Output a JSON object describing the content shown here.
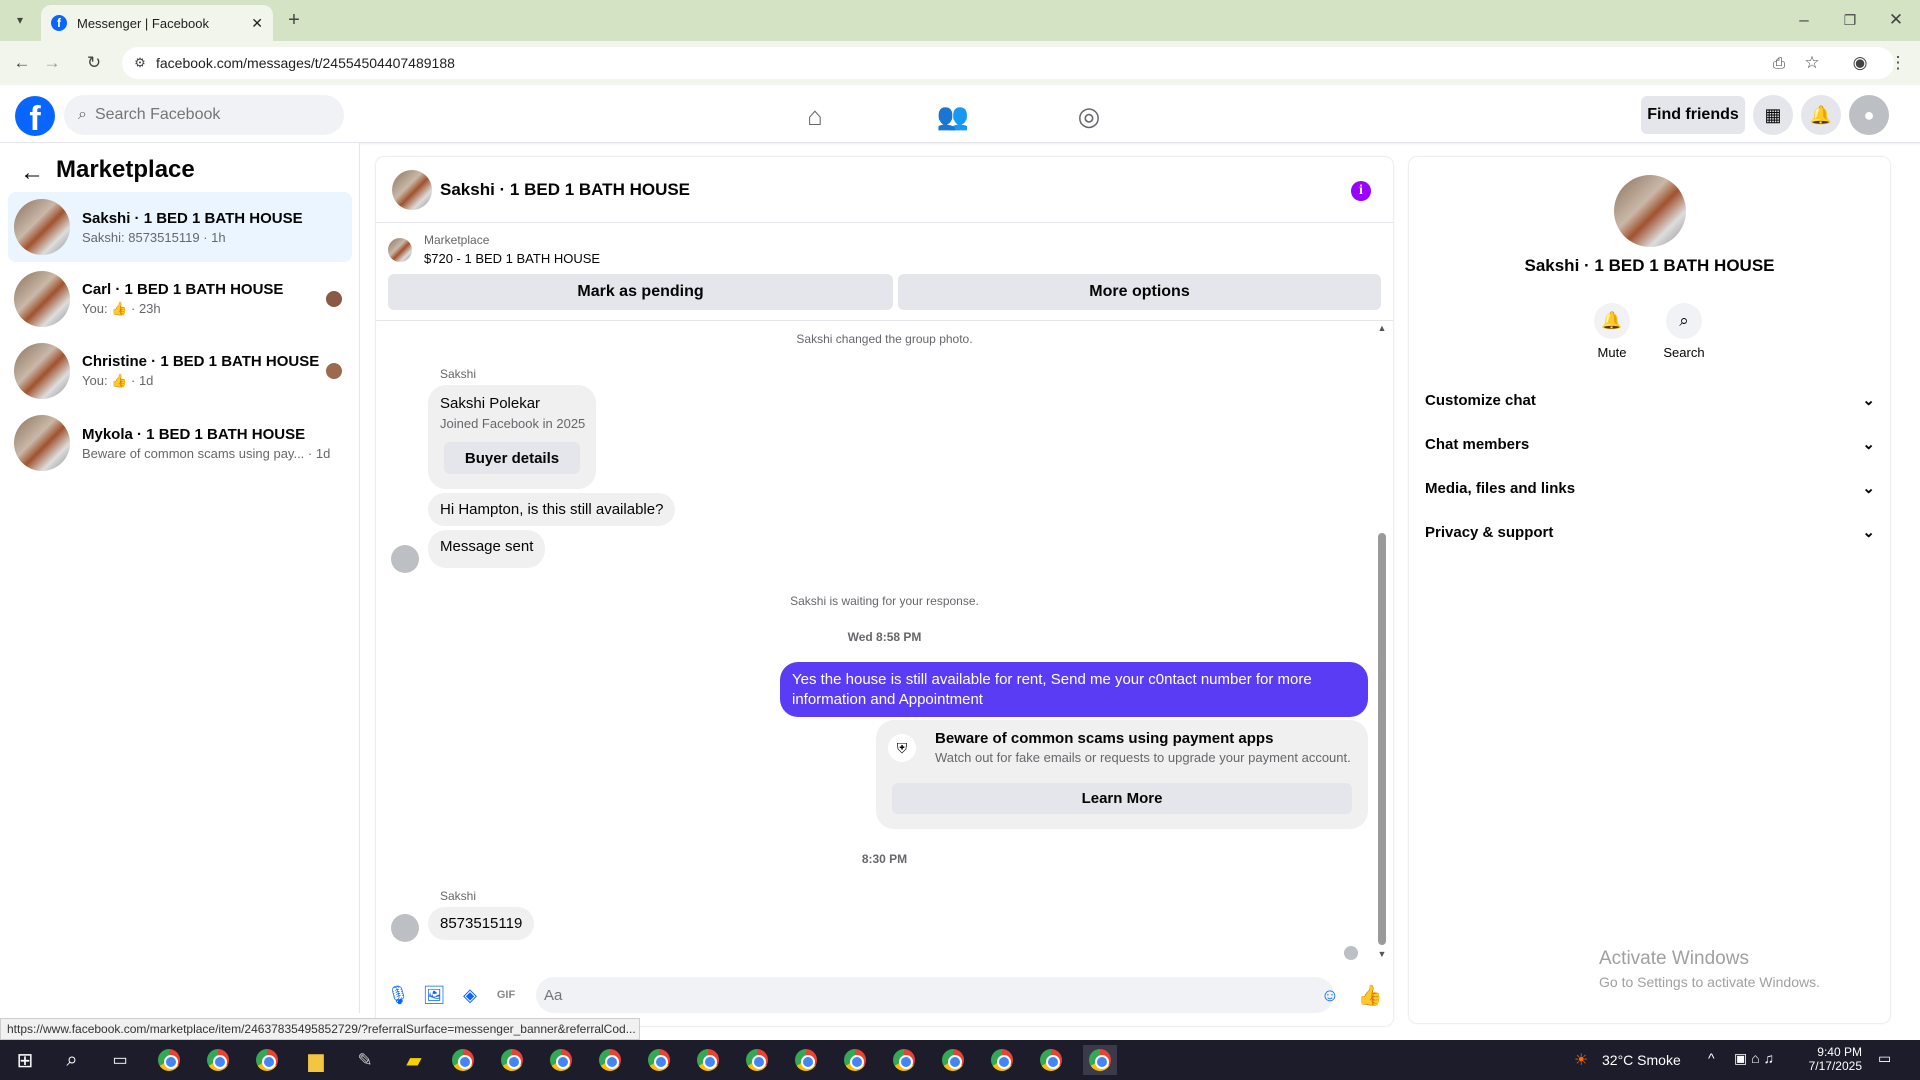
{
  "browser": {
    "tab_title": "Messenger | Facebook",
    "url": "facebook.com/messages/t/24554504407489188",
    "status_url": "https://www.facebook.com/marketplace/item/24637835495852729/?referralSurface=messenger_banner&referralCod..."
  },
  "header": {
    "logo": "f",
    "search_placeholder": "Search Facebook",
    "find_friends": "Find friends"
  },
  "left": {
    "title": "Marketplace",
    "conversations": [
      {
        "name": "Sakshi · 1 BED 1 BATH HOUSE",
        "sub": "Sakshi: 8573515119 · 1h"
      },
      {
        "name": "Carl · 1 BED 1 BATH HOUSE",
        "sub_prefix": "You:",
        "sub_time": "· 23h"
      },
      {
        "name": "Christine · 1 BED 1 BATH HOUSE",
        "sub_prefix": "You:",
        "sub_time": "· 1d"
      },
      {
        "name": "Mykola · 1 BED 1 BATH HOUSE",
        "sub": "Beware of common scams using pay...",
        "sub_time": "· 1d"
      }
    ]
  },
  "chat": {
    "title": "Sakshi · 1 BED 1 BATH HOUSE",
    "listing_label": "Marketplace",
    "listing_price": "$720 - 1 BED 1 BATH HOUSE",
    "mark_pending": "Mark as pending",
    "more_options": "More options",
    "sys_changed_photo": "Sakshi changed the group photo.",
    "sender_name": "Sakshi",
    "card_name": "Sakshi Polekar",
    "card_joined": "Joined Facebook in 2025",
    "buyer_details": "Buyer details",
    "msg_available": "Hi Hampton, is this still available?",
    "msg_sent": "Message sent",
    "sys_waiting": "Sakshi is waiting for your response.",
    "time_1": "Wed 8:58 PM",
    "out_msg": "Yes the house is still available for rent, Send me your c0ntact number for more information and Appointment",
    "scam_title": "Beware of common scams using payment apps",
    "scam_text": "Watch out for fake emails or requests to upgrade your payment account.",
    "learn_more": "Learn More",
    "time_2": "8:30 PM",
    "msg_number": "8573515119",
    "composer_placeholder": "Aa"
  },
  "right": {
    "name": "Sakshi · 1 BED 1 BATH HOUSE",
    "mute": "Mute",
    "search": "Search",
    "sections": [
      "Customize chat",
      "Chat members",
      "Media, files and links",
      "Privacy & support"
    ]
  },
  "watermark": {
    "line1": "Activate Windows",
    "line2": "Go to Settings to activate Windows."
  },
  "taskbar": {
    "weather": "32°C  Smoke",
    "time": "9:40 PM",
    "date": "7/17/2025"
  },
  "colors": {
    "accent": "#0866ff",
    "outgoing_bubble": "#5b3cf5",
    "info_icon": "#9b00ff"
  }
}
